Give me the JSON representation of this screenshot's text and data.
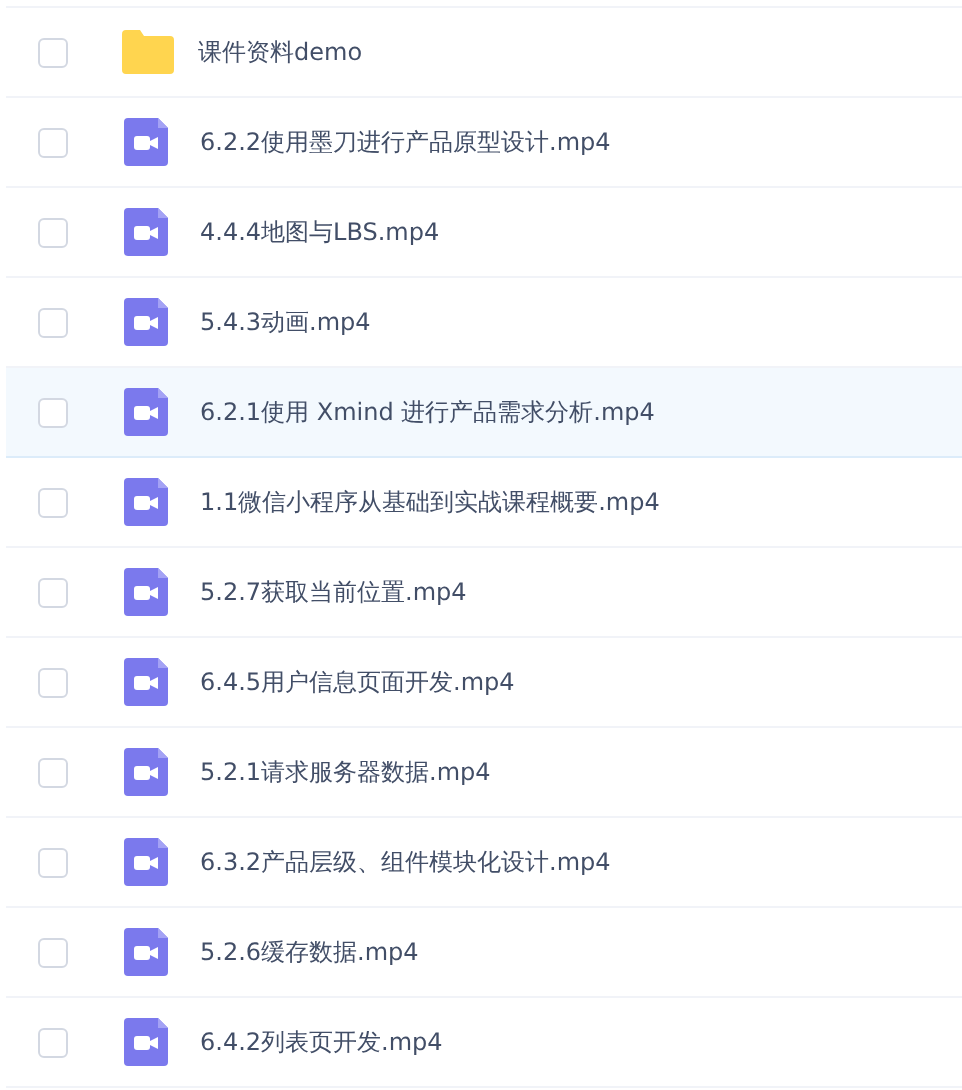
{
  "files": [
    {
      "kind": "folder",
      "name": "课件资料demo",
      "checked": false,
      "selected": false
    },
    {
      "kind": "video",
      "name": "6.2.2使用墨刀进行产品原型设计.mp4",
      "checked": false,
      "selected": false
    },
    {
      "kind": "video",
      "name": "4.4.4地图与LBS.mp4",
      "checked": false,
      "selected": false
    },
    {
      "kind": "video",
      "name": "5.4.3动画.mp4",
      "checked": false,
      "selected": false
    },
    {
      "kind": "video",
      "name": "6.2.1使用 Xmind 进行产品需求分析.mp4",
      "checked": false,
      "selected": true
    },
    {
      "kind": "video",
      "name": "1.1微信小程序从基础到实战课程概要.mp4",
      "checked": false,
      "selected": false
    },
    {
      "kind": "video",
      "name": "5.2.7获取当前位置.mp4",
      "checked": false,
      "selected": false
    },
    {
      "kind": "video",
      "name": "6.4.5用户信息页面开发.mp4",
      "checked": false,
      "selected": false
    },
    {
      "kind": "video",
      "name": "5.2.1请求服务器数据.mp4",
      "checked": false,
      "selected": false
    },
    {
      "kind": "video",
      "name": "6.3.2产品层级、组件模块化设计.mp4",
      "checked": false,
      "selected": false
    },
    {
      "kind": "video",
      "name": "5.2.6缓存数据.mp4",
      "checked": false,
      "selected": false
    },
    {
      "kind": "video",
      "name": "6.4.2列表页开发.mp4",
      "checked": false,
      "selected": false
    }
  ]
}
